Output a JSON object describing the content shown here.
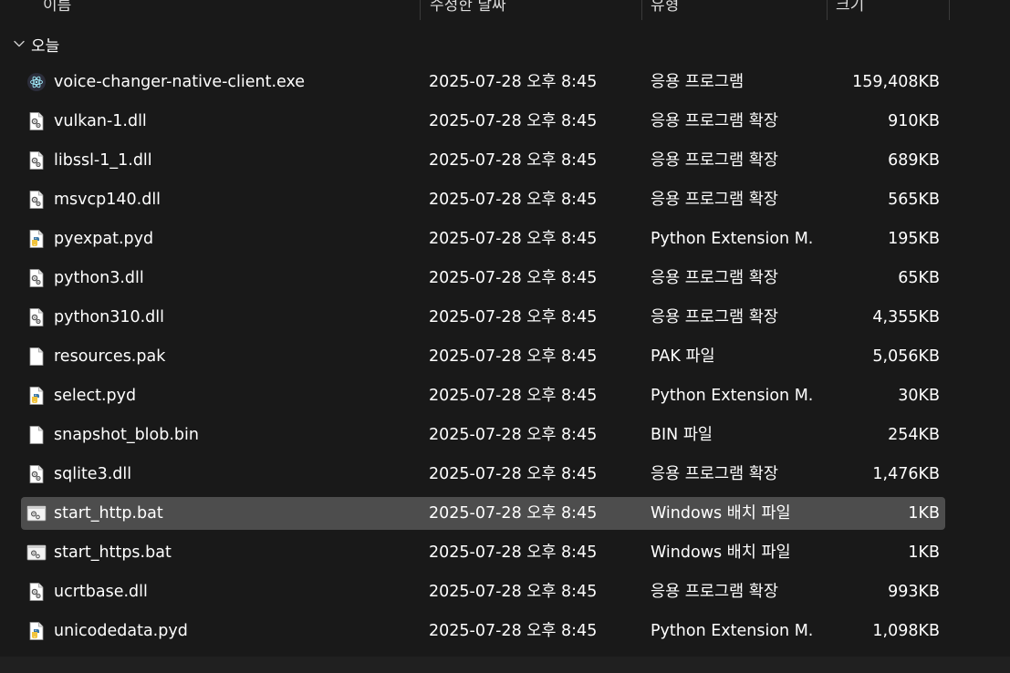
{
  "columns": {
    "name": "이름",
    "date_modified": "수정한 날짜",
    "type": "유형",
    "size": "크기"
  },
  "group": {
    "label": "오늘",
    "expanded": true
  },
  "files": [
    {
      "name": "voice-changer-native-client.exe",
      "date": "2025-07-28 오후 8:45",
      "type": "응용 프로그램",
      "size": "159,408KB",
      "icon": "electron-app-icon",
      "selected": false
    },
    {
      "name": "vulkan-1.dll",
      "date": "2025-07-28 오후 8:45",
      "type": "응용 프로그램 확장",
      "size": "910KB",
      "icon": "dll-file-icon",
      "selected": false
    },
    {
      "name": "libssl-1_1.dll",
      "date": "2025-07-28 오후 8:45",
      "type": "응용 프로그램 확장",
      "size": "689KB",
      "icon": "dll-file-icon",
      "selected": false
    },
    {
      "name": "msvcp140.dll",
      "date": "2025-07-28 오후 8:45",
      "type": "응용 프로그램 확장",
      "size": "565KB",
      "icon": "dll-file-icon",
      "selected": false
    },
    {
      "name": "pyexpat.pyd",
      "date": "2025-07-28 오후 8:45",
      "type": "Python Extension M...",
      "size": "195KB",
      "icon": "python-file-icon",
      "selected": false
    },
    {
      "name": "python3.dll",
      "date": "2025-07-28 오후 8:45",
      "type": "응용 프로그램 확장",
      "size": "65KB",
      "icon": "dll-file-icon",
      "selected": false
    },
    {
      "name": "python310.dll",
      "date": "2025-07-28 오후 8:45",
      "type": "응용 프로그램 확장",
      "size": "4,355KB",
      "icon": "dll-file-icon",
      "selected": false
    },
    {
      "name": "resources.pak",
      "date": "2025-07-28 오후 8:45",
      "type": "PAK 파일",
      "size": "5,056KB",
      "icon": "blank-file-icon",
      "selected": false
    },
    {
      "name": "select.pyd",
      "date": "2025-07-28 오후 8:45",
      "type": "Python Extension M...",
      "size": "30KB",
      "icon": "python-file-icon",
      "selected": false
    },
    {
      "name": "snapshot_blob.bin",
      "date": "2025-07-28 오후 8:45",
      "type": "BIN 파일",
      "size": "254KB",
      "icon": "blank-file-icon",
      "selected": false
    },
    {
      "name": "sqlite3.dll",
      "date": "2025-07-28 오후 8:45",
      "type": "응용 프로그램 확장",
      "size": "1,476KB",
      "icon": "dll-file-icon",
      "selected": false
    },
    {
      "name": "start_http.bat",
      "date": "2025-07-28 오후 8:45",
      "type": "Windows 배치 파일",
      "size": "1KB",
      "icon": "batch-file-icon",
      "selected": true
    },
    {
      "name": "start_https.bat",
      "date": "2025-07-28 오후 8:45",
      "type": "Windows 배치 파일",
      "size": "1KB",
      "icon": "batch-file-icon",
      "selected": false
    },
    {
      "name": "ucrtbase.dll",
      "date": "2025-07-28 오후 8:45",
      "type": "응용 프로그램 확장",
      "size": "993KB",
      "icon": "dll-file-icon",
      "selected": false
    },
    {
      "name": "unicodedata.pyd",
      "date": "2025-07-28 오후 8:45",
      "type": "Python Extension M...",
      "size": "1,098KB",
      "icon": "python-file-icon",
      "selected": false
    }
  ],
  "colors": {
    "background": "#191919",
    "selected_row": "#4d4d4d",
    "text": "#ffffff",
    "python_blue": "#3b77a8",
    "python_yellow": "#f2c43c"
  }
}
